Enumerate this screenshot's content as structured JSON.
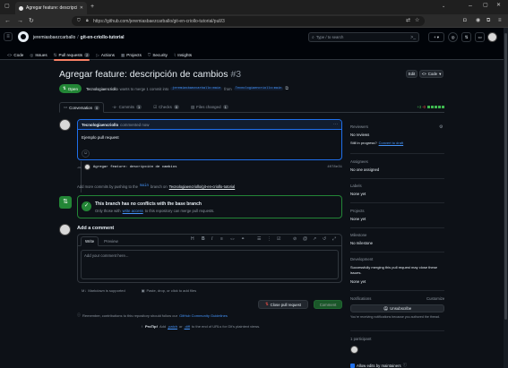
{
  "browser": {
    "tab_title": "Agregar feature: descripción de ca",
    "url": "https://github.com/jeremiasbaezcarballo/git-en-criollo-tutorial/pull/3"
  },
  "header": {
    "owner": "jeremiasbaezcarballo",
    "repo": "git-en-criollo-tutorial",
    "search_placeholder": "Type / to search",
    "nav": [
      {
        "label": "Code",
        "count": ""
      },
      {
        "label": "Issues",
        "count": ""
      },
      {
        "label": "Pull requests",
        "count": "2"
      },
      {
        "label": "Actions",
        "count": ""
      },
      {
        "label": "Projects",
        "count": ""
      },
      {
        "label": "Security",
        "count": ""
      },
      {
        "label": "Insights",
        "count": ""
      }
    ]
  },
  "pr": {
    "title": "Agregar feature: descripción de cambios",
    "number": "#3",
    "state": "Open",
    "author": "Tecnologiaencriollo",
    "summary_mid": "wants to merge 1 commit into",
    "base_branch": "jeremiasbaezcarballo:main",
    "summary_from": "from",
    "head_branch": "Tecnologiaencriollo:main",
    "edit_label": "Edit",
    "code_label": "Code",
    "tabs": [
      {
        "label": "Conversation",
        "count": "0"
      },
      {
        "label": "Commits",
        "count": "1"
      },
      {
        "label": "Checks",
        "count": "0"
      },
      {
        "label": "Files changed",
        "count": "1"
      }
    ],
    "diffstat_add": "+3",
    "diffstat_del": "-0"
  },
  "comment": {
    "author": "Tecnologiaencriollo",
    "meta": "commented now",
    "body": "Ejemplo pull request",
    "menu": "···"
  },
  "commit": {
    "message": "Agregar feature: descripción de cambios",
    "sha": "4078e31"
  },
  "hint": {
    "pre": "Add more commits by pushing to the",
    "branch": "main",
    "mid": "branch on",
    "repo": "Tecnologiaencriollo/git-en-criollo-tutorial",
    "post": "."
  },
  "merge": {
    "title": "This branch has no conflicts with the base branch",
    "pre": "Only those with",
    "link": "write access",
    "post": "to this repository can merge pull requests."
  },
  "add_comment": {
    "heading": "Add a comment",
    "write_tab": "Write",
    "preview_tab": "Preview",
    "placeholder": "Add your comment here...",
    "markdown_note": "Markdown is supported",
    "paste_note": "Paste, drop, or click to add files",
    "close_label": "Close pull request",
    "comment_label": "Comment"
  },
  "footer": {
    "reminder_pre": "Remember, contributions to this repository should follow our",
    "reminder_link": "GitHub Community Guidelines",
    "reminder_post": ".",
    "protip_label": "ProTip!",
    "protip_pre": "Add",
    "protip_patch": ".patch",
    "protip_or": "or",
    "protip_diff": ".diff",
    "protip_post": "to the end of URLs for Git's plaintext views."
  },
  "sidebar": {
    "reviewers_h": "Reviewers",
    "reviewers_v": "No reviews",
    "wip_pre": "Still in progress?",
    "wip_link": "Convert to draft",
    "assignees_h": "Assignees",
    "assignees_v": "No one assigned",
    "labels_h": "Labels",
    "labels_v": "None yet",
    "projects_h": "Projects",
    "projects_v": "None yet",
    "milestone_h": "Milestone",
    "milestone_v": "No milestone",
    "development_h": "Development",
    "development_v": "Successfully merging this pull request may close these issues.",
    "development_v2": "None yet",
    "notifications_h": "Notifications",
    "customize": "Customize",
    "unsubscribe": "Unsubscribe",
    "notif_note": "You're receiving notifications because you authored the thread.",
    "participants_h": "1 participant",
    "allow_edits": "Allow edits by maintainers"
  },
  "colors": {
    "accent": "#4493f8",
    "green": "#238636",
    "bg": "#0d1117"
  }
}
